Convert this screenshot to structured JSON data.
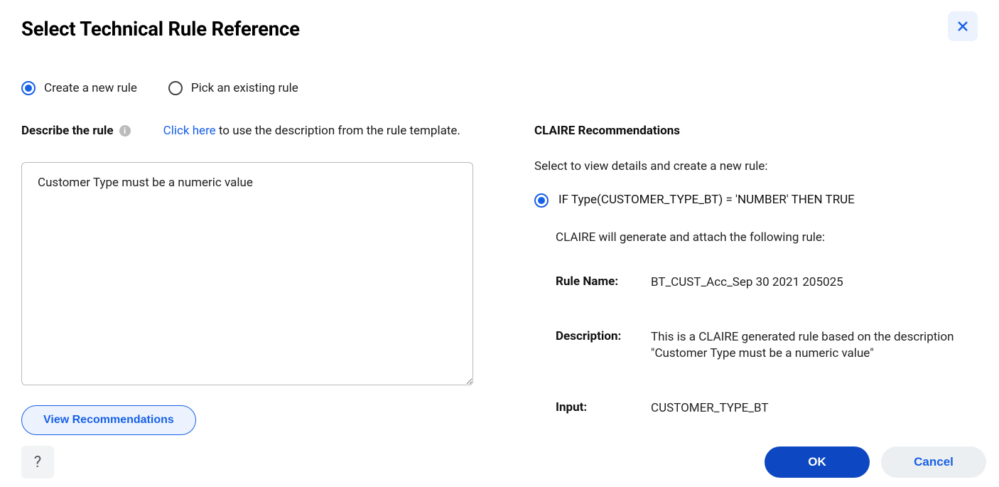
{
  "dialog": {
    "title": "Select Technical Rule Reference"
  },
  "mode": {
    "create_label": "Create a new rule",
    "pick_label": "Pick an existing rule",
    "selected": "create"
  },
  "describe": {
    "label": "Describe the rule",
    "link_text": "Click here",
    "suffix_text": " to use the description from the rule template.",
    "value": "Customer Type must be a numeric value"
  },
  "view_rec_button": "View Recommendations",
  "recommendations": {
    "title": "CLAIRE Recommendations",
    "subtitle": "Select to view details and create a new rule:",
    "option": "IF Type(CUSTOMER_TYPE_BT) = 'NUMBER' THEN TRUE",
    "attach_note": "CLAIRE will generate and attach the following rule:",
    "rule_name_label": "Rule Name:",
    "rule_name_value": "BT_CUST_Acc_Sep 30 2021 205025",
    "description_label": "Description:",
    "description_value": "This is a CLAIRE generated rule based on the description \"Customer Type must be a numeric value\"",
    "input_label": "Input:",
    "input_value": "CUSTOMER_TYPE_BT"
  },
  "footer": {
    "ok": "OK",
    "cancel": "Cancel"
  }
}
